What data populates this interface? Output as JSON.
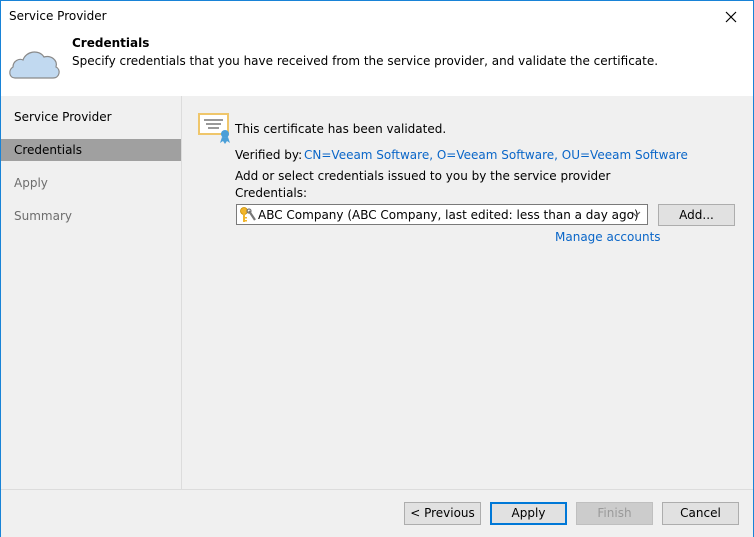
{
  "window": {
    "title": "Service Provider",
    "close_icon": "close-icon"
  },
  "header": {
    "icon": "cloud-icon",
    "title": "Credentials",
    "description": "Specify credentials that you have received from the service provider, and validate the certificate."
  },
  "sidebar": {
    "items": [
      {
        "label": "Service Provider",
        "state": "normal"
      },
      {
        "label": "Credentials",
        "state": "active"
      },
      {
        "label": "Apply",
        "state": "disabled"
      },
      {
        "label": "Summary",
        "state": "disabled"
      }
    ]
  },
  "content": {
    "certificate_icon": "certificate-icon",
    "certificate_status": "This certificate has been validated.",
    "verified_by_label": "Verified by:",
    "verified_by_value": "CN=Veeam Software, O=Veeam Software, OU=Veeam Software",
    "instruction": "Add or select credentials issued to you by the service provider",
    "credentials_label": "Credentials:",
    "credentials_value": "ABC Company (ABC Company, last edited: less than a day ago)",
    "add_button": "Add...",
    "manage_link": "Manage accounts"
  },
  "footer": {
    "previous": "< Previous",
    "apply": "Apply",
    "finish": "Finish",
    "cancel": "Cancel"
  },
  "colors": {
    "accent": "#0078d7",
    "link": "#0a66c8",
    "active_step": "#a0a0a0"
  }
}
